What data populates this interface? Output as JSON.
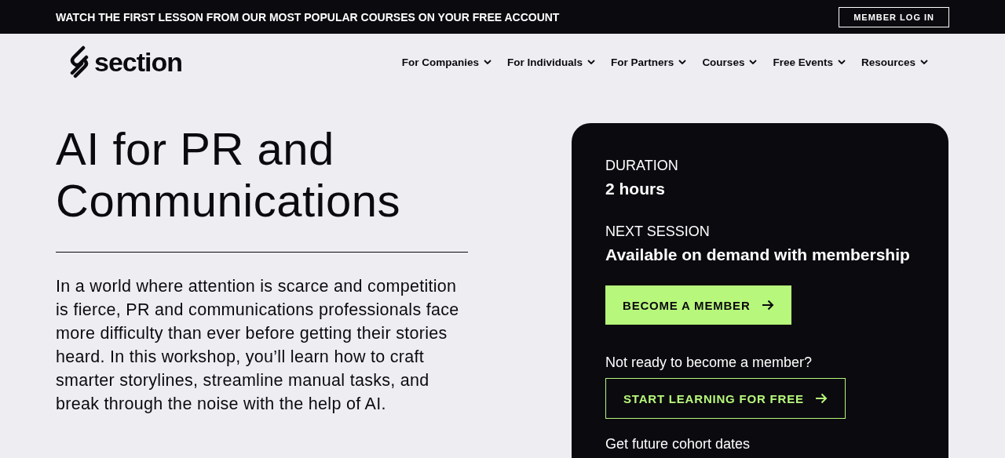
{
  "banner": {
    "text": "WATCH THE FIRST LESSON FROM OUR MOST POPULAR COURSES ON YOUR FREE ACCOUNT",
    "login_button": "MEMBER LOG IN"
  },
  "logo": {
    "text": "section"
  },
  "nav": [
    {
      "label": "For Companies"
    },
    {
      "label": "For Individuals"
    },
    {
      "label": "For Partners"
    },
    {
      "label": "Courses"
    },
    {
      "label": "Free Events"
    },
    {
      "label": "Resources"
    }
  ],
  "hero": {
    "title": "AI for PR and Communications",
    "description": "In a world where attention is scarce and competition is fierce, PR and communications professionals face more difficulty than ever before getting their stories heard. In this workshop, you’ll learn how to craft smarter storylines, streamline manual tasks, and break through the noise with the help of AI."
  },
  "card": {
    "facts": [
      {
        "label": "DURATION",
        "value": "2 hours"
      },
      {
        "label": "NEXT SESSION",
        "value": "Available on demand with membership"
      }
    ],
    "primary_button": "BECOME A MEMBER",
    "prompt": "Not ready to become a member?",
    "secondary_button": "START LEARNING FOR FREE",
    "footer": "Get future cohort dates"
  }
}
